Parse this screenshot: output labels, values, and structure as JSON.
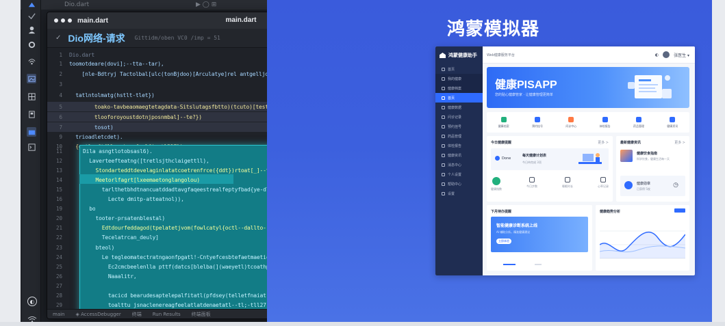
{
  "editor": {
    "file_name": "main.dart",
    "window_title": "main.dart",
    "win_ctrls": [
      "⎯",
      "☐",
      "✕"
    ],
    "section_title": "Dio网络-请求",
    "section_subtitle": "Gittidm/oben VC0 /imp = 51",
    "close": "✕",
    "bg_tabs": [
      "Dio.dart",
      "▶ ◯ ⊞"
    ],
    "status_items": [
      "main",
      "◈ AccessDebugger",
      "终端",
      "Run Results",
      "终端面板"
    ],
    "lines": [
      {
        "n": "1",
        "t": "Dio.dart",
        "cls": "dim"
      },
      {
        "n": "1",
        "t": "toomotdeare(dovi];--tta--tar),",
        "cls": ""
      },
      {
        "n": "2",
        "t": "    [nle-Bdtryj Tactolbal[ulc(tonBjdoo)[Arculatye]rel antgelljo--tal2l]);",
        "cls": ""
      },
      {
        "n": "3",
        "t": "",
        "cls": ""
      },
      {
        "n": "4",
        "t": "  tatlntolmatg(hstlt-tlet})",
        "cls": ""
      },
      {
        "n": "5",
        "t": "        toako-tavbeaomaegtetagdata-Sitslutagsfbtto)(tcuto)[test}-tl?])",
        "cls": "yellow"
      },
      {
        "n": "6",
        "t": "        tlooforoyoustdotnjposnmbal]--te?})",
        "cls": "yellow"
      },
      {
        "n": "7",
        "t": "        tosot)",
        "cls": ""
      },
      {
        "n": "9",
        "t": "  trioadletcdet).",
        "cls": ""
      },
      {
        "n": "10",
        "t": "  {ortlooft{llcomtyrpfvolfis-tl217})",
        "cls": "orange"
      }
    ],
    "teal_lines": [
      {
        "n": "11",
        "t": "Dila asngtlotobsasl6).",
        "cls": ""
      },
      {
        "n": "12",
        "t": "  Laverteefteatng([tretlsjthclaigettll),",
        "cls": ""
      },
      {
        "n": "13",
        "t": "    Stondarteddtdevelaginlatatcoetrenfrce({ddt})rtoat[_]--tlot}}.",
        "cls": "y"
      },
      {
        "n": "14",
        "t": "    Meetorlfagrt[lxeemaetonglangolou)",
        "cls": "y"
      },
      {
        "n": "15",
        "t": "      tarlthetbhdtnancuatddadtavgfaqeestrealfeptyfbad{ye-dlol-tocinatrvcelgrnleadaa{)]-tal]),",
        "cls": ""
      },
      {
        "n": "16",
        "t": "        Lecte dmitp-atteatnol)),",
        "cls": ""
      },
      {
        "n": "19",
        "t": "  bo",
        "cls": ""
      },
      {
        "n": "20",
        "t": "    tooter-prsatenblestal)",
        "cls": ""
      },
      {
        "n": "21",
        "t": "      Edtdourfeddagod(tpelatetjvom(fowlcatyl{octl--dallto-(ld)_]tt3l),",
        "cls": "y"
      },
      {
        "n": "22",
        "t": "      Tecelatrcan_deuly]",
        "cls": ""
      },
      {
        "n": "23",
        "t": "    bteol)",
        "cls": ""
      },
      {
        "n": "24",
        "t": "      Le tegleomatectratngaonfpgatl!-Cntyefcesbtefaetmaetice(mess)rioeeRecnphtnthnetrloro(0)),",
        "cls": ""
      },
      {
        "n": "25",
        "t": "        Ec2cmcbeelenlla pttf(datcs[blelba(](waeyetl)tcoathp(intoncfetra[1]-tal27})),",
        "cls": ""
      },
      {
        "n": "26",
        "t": "        Naaalitr,",
        "cls": ""
      },
      {
        "n": "27",
        "t": "",
        "cls": ""
      },
      {
        "n": "28",
        "t": "        tacicd bearudesaptelepalfitatl(pfdsey(telletfnaiat);fuertbearl(ingerteel)octdtotntllotts-tLlg.18),",
        "cls": ""
      },
      {
        "n": "29",
        "t": "        toalttu jsnaclenereagfeelatlatdenaetatl--tl;-tll27),",
        "cls": ""
      }
    ]
  },
  "simulator": {
    "title": "鸿蒙模拟器",
    "app": {
      "logo_text": "鸿蒙健康助手",
      "header_left": "Web健康服务平台",
      "header_user": "张医生 ▾",
      "menu": [
        {
          "label": "首页",
          "active": false
        },
        {
          "label": "我的健康",
          "active": false
        },
        {
          "label": "健康档案",
          "active": false
        },
        {
          "label": "首页",
          "active": true
        },
        {
          "label": "健康数据",
          "active": false
        },
        {
          "label": "问诊记录",
          "active": false
        },
        {
          "label": "预约挂号",
          "active": false
        },
        {
          "label": "药品管理",
          "active": false
        },
        {
          "label": "体检报告",
          "active": false
        },
        {
          "label": "健康资讯",
          "active": false
        },
        {
          "label": "消息中心",
          "active": false
        },
        {
          "label": "个人设置",
          "active": false
        },
        {
          "label": "帮助中心",
          "active": false
        },
        {
          "label": "设置",
          "active": false
        }
      ],
      "hero_title": "健康PISAPP",
      "hero_subtitle": "您的贴心健康管家 · 让健康管理更简单",
      "quick": [
        {
          "label": "健康档案",
          "color": "#22b07d"
        },
        {
          "label": "预约挂号",
          "color": "#2f6bff"
        },
        {
          "label": "问诊中心",
          "color": "#ff7a45"
        },
        {
          "label": "体检报告",
          "color": "#2f6bff"
        },
        {
          "label": "药品管理",
          "color": "#2f6bff"
        },
        {
          "label": "健康资讯",
          "color": "#2f6bff"
        }
      ],
      "card_today": {
        "title": "今日健康提醒",
        "more": "更多 >",
        "item_title": "每天健康计划表",
        "item_sub": "今日待完成 3项",
        "done": "Done"
      },
      "card_news": {
        "title": "最新健康资讯",
        "more": "更多 >",
        "item_title": "健康饮食指南",
        "item_sub": "科学饮食，健康生活每一天"
      },
      "stats": [
        {
          "label": "健康指数"
        },
        {
          "label": "今日步数"
        },
        {
          "label": "睡眠时长"
        },
        {
          "label": "心率记录"
        }
      ],
      "badge": {
        "title": "健康勋章",
        "sub": "已获得 5枚"
      },
      "bottom_left": {
        "title": "下月待办提醒",
        "banner_title": "智能健康诊断系统上线",
        "banner_sub": "AI 辅助分析，精准健康建议",
        "banner_btn": "立即体验"
      },
      "bottom_right": {
        "title": "健康趋势分析"
      }
    }
  }
}
